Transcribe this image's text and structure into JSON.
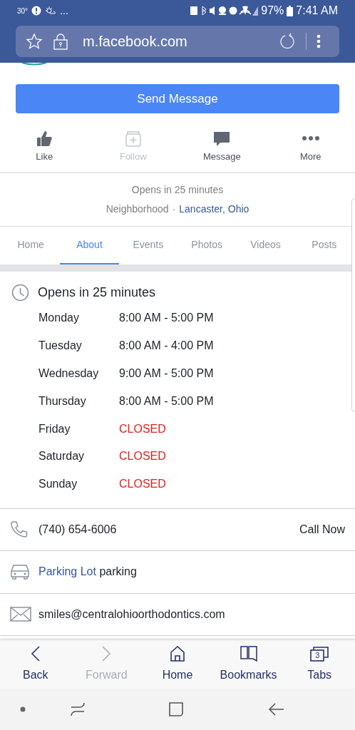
{
  "status_bar": {
    "temperature": "30°",
    "ellipsis": "...",
    "battery": "97%",
    "time": "7:41 AM"
  },
  "address_bar": {
    "url": "m.facebook.com"
  },
  "send_button": "Send Message",
  "actions": [
    {
      "kind": "like",
      "label": "Like",
      "disabled": false
    },
    {
      "kind": "follow",
      "label": "Follow",
      "disabled": true
    },
    {
      "kind": "message",
      "label": "Message",
      "disabled": false
    },
    {
      "kind": "more",
      "label": "More",
      "disabled": false
    }
  ],
  "info": {
    "status": "Opens in 25 minutes",
    "category": "Neighborhood",
    "separator": "·",
    "location": "Lancaster, Ohio"
  },
  "tabs": [
    {
      "label": "Home",
      "selected": false
    },
    {
      "label": "About",
      "selected": true
    },
    {
      "label": "Events",
      "selected": false
    },
    {
      "label": "Photos",
      "selected": false
    },
    {
      "label": "Videos",
      "selected": false
    },
    {
      "label": "Posts",
      "selected": false
    }
  ],
  "hours": {
    "title": "Opens in 25 minutes",
    "days": [
      {
        "day": "Monday",
        "time": "8:00 AM - 5:00 PM",
        "closed": false
      },
      {
        "day": "Tuesday",
        "time": "8:00 AM - 4:00 PM",
        "closed": false
      },
      {
        "day": "Wednesday",
        "time": "9:00 AM - 5:00 PM",
        "closed": false
      },
      {
        "day": "Thursday",
        "time": "8:00 AM - 5:00 PM",
        "closed": false
      },
      {
        "day": "Friday",
        "time": "CLOSED",
        "closed": true
      },
      {
        "day": "Saturday",
        "time": "CLOSED",
        "closed": true
      },
      {
        "day": "Sunday",
        "time": "CLOSED",
        "closed": true
      }
    ]
  },
  "contacts": [
    {
      "kind": "phone",
      "text": "(740) 654-6006",
      "action": "Call Now"
    },
    {
      "kind": "parking",
      "link": "Parking Lot",
      "text": "parking"
    },
    {
      "kind": "email",
      "text": "smiles@centralohioorthodontics.com"
    }
  ],
  "browser_nav": [
    {
      "kind": "back",
      "label": "Back",
      "disabled": false
    },
    {
      "kind": "forward",
      "label": "Forward",
      "disabled": true
    },
    {
      "kind": "home",
      "label": "Home",
      "disabled": false
    },
    {
      "kind": "bookmarks",
      "label": "Bookmarks",
      "disabled": false
    },
    {
      "kind": "tabs",
      "label": "Tabs",
      "count": "3",
      "disabled": false
    }
  ]
}
